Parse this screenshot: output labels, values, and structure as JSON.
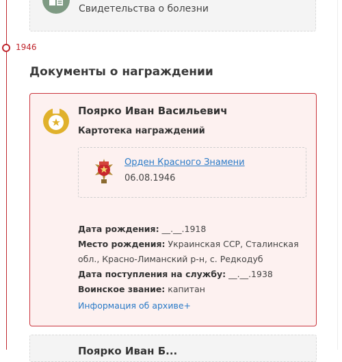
{
  "top_card": {
    "label": "Свидетельства о болезни",
    "icon": "hospital-document-icon"
  },
  "timeline": {
    "year": "1946"
  },
  "section": {
    "title": "Документы о награждении"
  },
  "award_card": {
    "name": "Поярко Иван Васильевич",
    "doc_type": "Картотека награждений",
    "award": {
      "title": "Орден Красного Знамени",
      "date": "06.08.1946",
      "icon": "order-red-banner-icon"
    },
    "facts": [
      {
        "label": "Дата рождения:",
        "value": "__.__.1918"
      },
      {
        "label": "Место рождения:",
        "value": "Украинская ССР, Сталинская обл., Красно-Лиманский р-н, с. Редкодуб"
      },
      {
        "label": "Дата поступления на службу:",
        "value": "__.__.1938"
      },
      {
        "label": "Воинское звание:",
        "value": "капитан"
      }
    ],
    "archive_link": "Информация об архиве+"
  },
  "next_card": {
    "name_partial": "Поярко Иван Б..."
  },
  "colors": {
    "accent": "#c0262d",
    "link": "#2a7ac7",
    "card_bg": "#fdf1f0",
    "medal": "#e0b12b"
  }
}
